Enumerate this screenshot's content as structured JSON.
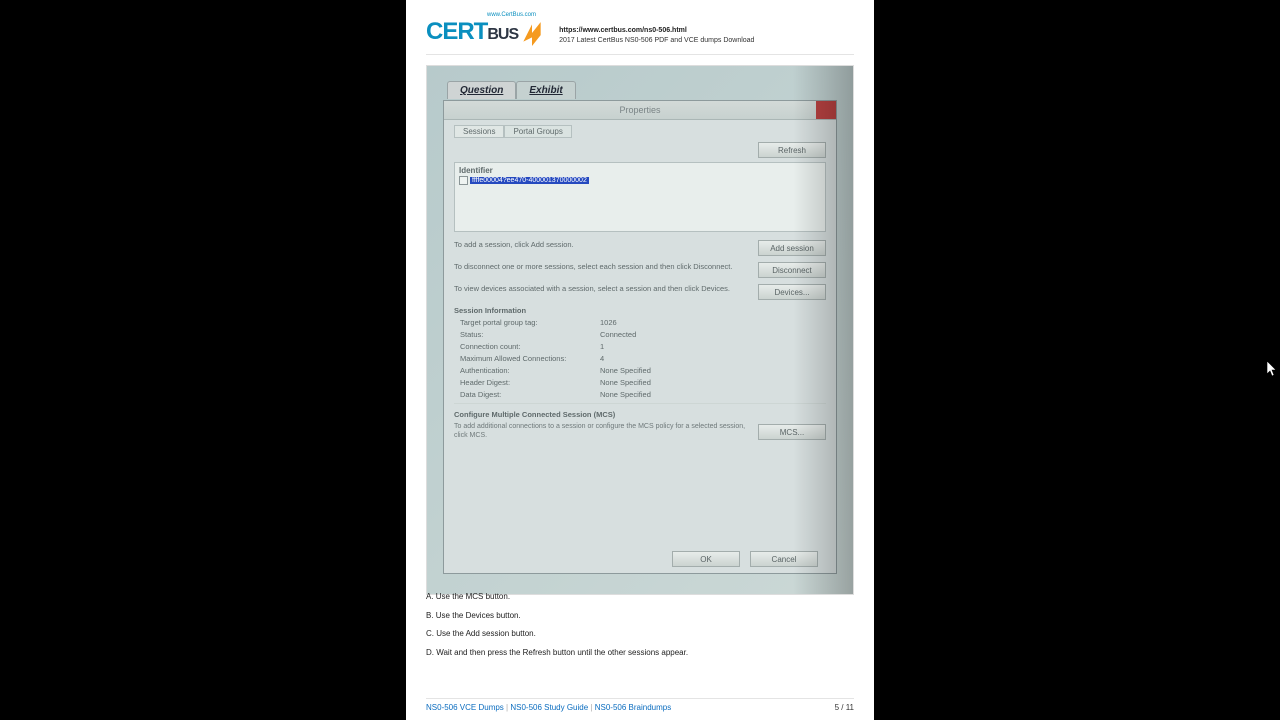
{
  "header": {
    "logo_small": "www.CertBus.com",
    "logo_cert": "CERT",
    "logo_bus": "BUS",
    "url": "https://www.certbus.com/ns0-506.html",
    "desc": "2017 Latest CertBus NS0-506 PDF and VCE dumps Download"
  },
  "outer_tabs": {
    "t1": "Question",
    "t2": "Exhibit"
  },
  "dialog": {
    "title": "Properties",
    "inner_tabs": {
      "t1": "Sessions",
      "t2": "Portal Groups"
    },
    "refresh": "Refresh",
    "list_header": "Identifier",
    "list_item": "ffffe00004?ee470-400001370000002",
    "instr1": "To add a session, click Add session.",
    "btn_add": "Add session",
    "instr2": "To disconnect one or more sessions, select each session and then click Disconnect.",
    "btn_disc": "Disconnect",
    "instr3": "To view devices associated with a session, select a session and then click Devices.",
    "btn_dev": "Devices...",
    "section_info": "Session Information",
    "kv": [
      {
        "k": "Target portal group tag:",
        "v": "1026"
      },
      {
        "k": "Status:",
        "v": "Connected"
      },
      {
        "k": "Connection count:",
        "v": "1"
      },
      {
        "k": "Maximum Allowed Connections:",
        "v": "4"
      },
      {
        "k": "Authentication:",
        "v": "None Specified"
      },
      {
        "k": "Header Digest:",
        "v": "None Specified"
      },
      {
        "k": "Data Digest:",
        "v": "None Specified"
      }
    ],
    "mcs_title": "Configure Multiple Connected Session (MCS)",
    "mcs_text": "To add additional connections to a session or configure the MCS policy for a selected session, click MCS.",
    "btn_mcs": "MCS...",
    "btn_ok": "OK",
    "btn_cancel": "Cancel"
  },
  "answers": {
    "a": "A. Use the MCS button.",
    "b": "B. Use the Devices button.",
    "c": "C. Use the Add session button.",
    "d": "D. Wait and then press the Refresh button until the other sessions appear."
  },
  "footer": {
    "l1": "NS0-506 VCE Dumps",
    "l2": "NS0-506 Study Guide",
    "l3": "NS0-506 Braindumps",
    "page": "5 / 11"
  }
}
